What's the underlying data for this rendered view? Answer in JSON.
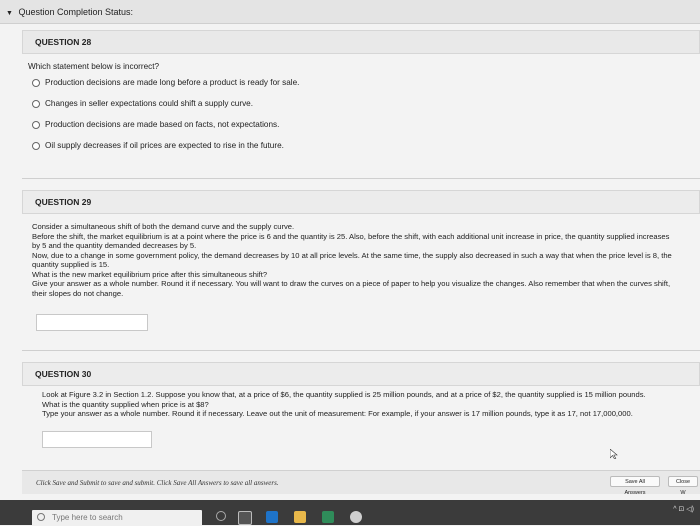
{
  "status_bar": {
    "label": "Question Completion Status:"
  },
  "q28": {
    "title": "QUESTION 28",
    "prompt": "Which statement below is incorrect?",
    "options": [
      "Production decisions are made long before a product is ready for sale.",
      "Changes in seller expectations could shift a supply curve.",
      "Production decisions are made based on facts, not expectations.",
      "Oil supply decreases if oil prices are expected to rise in the future."
    ]
  },
  "q29": {
    "title": "QUESTION 29",
    "lines": [
      "Consider a simultaneous shift of both the demand curve and the supply curve.",
      "Before the shift, the market equilibrium is at a point where the price is 6 and the quantity is 25. Also, before the shift, with each additional unit increase in price, the quantity supplied increases by 5 and the quantity demanded decreases by 5.",
      "Now, due to a change in some government policy, the demand decreases by 10 at all price levels. At the same time, the supply also decreased in such a way that when the price level is 8, the quantity supplied is 15.",
      "What is the new market equilibrium price after this simultaneous shift?",
      "Give your answer as a whole number. Round it if necessary. You will want to draw the curves on a piece of paper to help you visualize the changes. Also remember that when the curves shift, their slopes do not change."
    ],
    "answer": ""
  },
  "q30": {
    "title": "QUESTION 30",
    "lines": [
      "Look at Figure 3.2 in Section 1.2. Suppose you know that, at a price of $6, the quantity supplied is 25 million pounds, and at a price of $2, the quantity supplied is 15 million pounds. What is the quantity supplied when price is at $8?",
      "Type your answer as a whole number. Round it if necessary. Leave out the unit of measurement: For example, if your answer is 17 million pounds, type it as 17, not 17,000,000."
    ],
    "answer": ""
  },
  "footer": {
    "note": "Click Save and Submit to save and submit. Click Save All Answers to save all answers.",
    "save_all": "Save All Answers",
    "save_submit": "Close W"
  },
  "taskbar": {
    "search_placeholder": "Type here to search",
    "tray": "^  ⊡  ◁)"
  }
}
